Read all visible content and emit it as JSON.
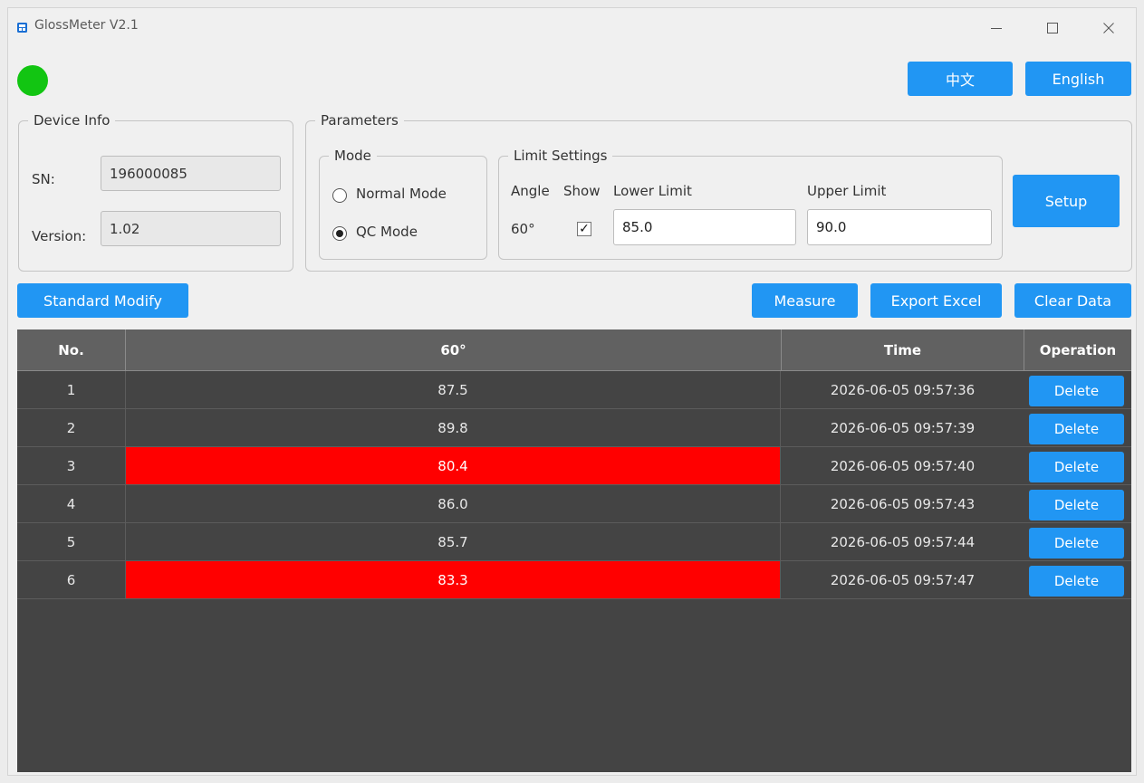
{
  "window": {
    "title": "GlossMeter V2.1"
  },
  "language": {
    "chinese_label": "中文",
    "english_label": "English"
  },
  "colors": {
    "accent": "#2196f3",
    "status_connected": "#12c512",
    "out_of_limit": "#ff0000",
    "table_bg": "#444444",
    "table_header_bg": "#616161"
  },
  "device_info": {
    "title": "Device Info",
    "sn_label": "SN:",
    "sn_value": "196000085",
    "version_label": "Version:",
    "version_value": "1.02"
  },
  "parameters": {
    "title": "Parameters",
    "mode": {
      "title": "Mode",
      "options": [
        {
          "label": "Normal Mode",
          "selected": false
        },
        {
          "label": "QC Mode",
          "selected": true
        }
      ]
    },
    "limits": {
      "title": "Limit Settings",
      "col_angle": "Angle",
      "col_show": "Show",
      "col_lower": "Lower Limit",
      "col_upper": "Upper Limit",
      "angle_value": "60°",
      "show_checked": true,
      "show_mark": "✓",
      "lower_value": "85.0",
      "upper_value": "90.0"
    },
    "setup_label": "Setup"
  },
  "actions": {
    "standard_modify": "Standard Modify",
    "measure": "Measure",
    "export_excel": "Export Excel",
    "clear_data": "Clear Data"
  },
  "table": {
    "headers": [
      "No.",
      "60°",
      "Time",
      "Operation"
    ],
    "delete_label": "Delete",
    "rows": [
      {
        "no": "1",
        "value": "87.5",
        "time": "2026-06-05 09:57:36",
        "out_of_limit": false
      },
      {
        "no": "2",
        "value": "89.8",
        "time": "2026-06-05 09:57:39",
        "out_of_limit": false
      },
      {
        "no": "3",
        "value": "80.4",
        "time": "2026-06-05 09:57:40",
        "out_of_limit": true
      },
      {
        "no": "4",
        "value": "86.0",
        "time": "2026-06-05 09:57:43",
        "out_of_limit": false
      },
      {
        "no": "5",
        "value": "85.7",
        "time": "2026-06-05 09:57:44",
        "out_of_limit": false
      },
      {
        "no": "6",
        "value": "83.3",
        "time": "2026-06-05 09:57:47",
        "out_of_limit": true
      }
    ]
  }
}
